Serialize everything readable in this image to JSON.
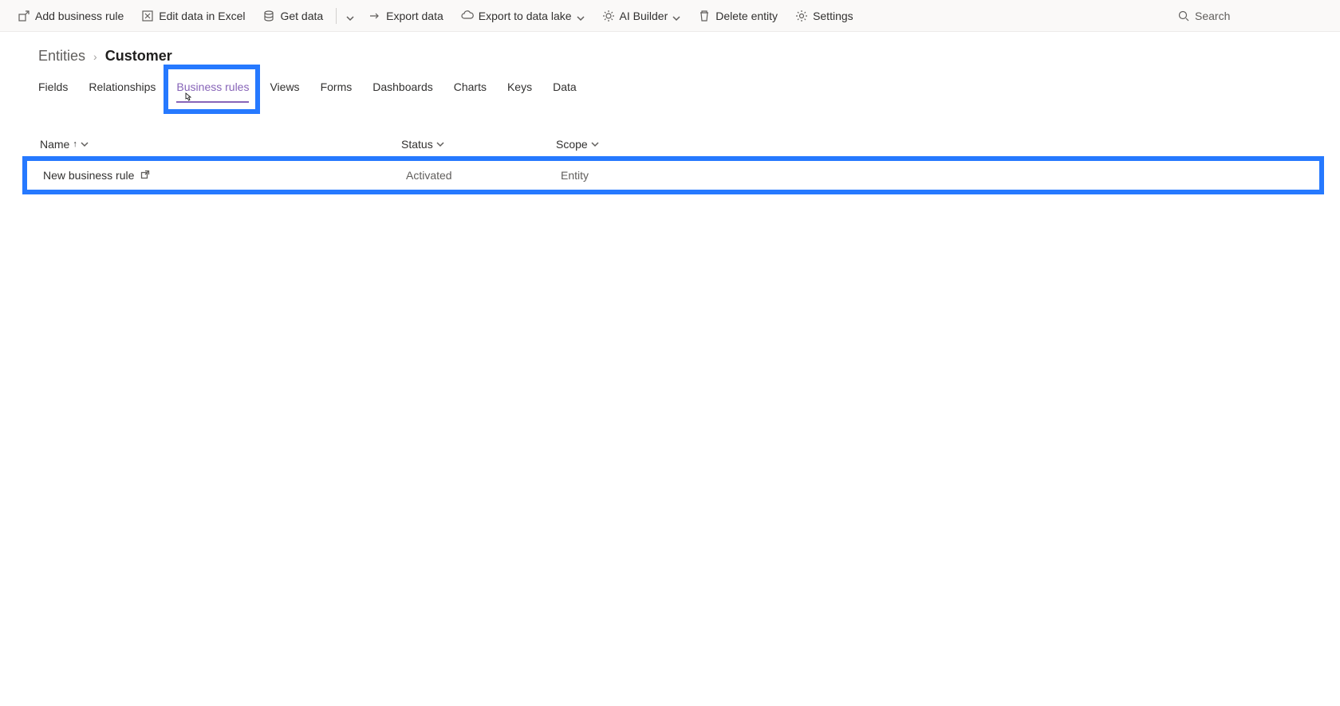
{
  "commandBar": {
    "addBusinessRule": "Add business rule",
    "editInExcel": "Edit data in Excel",
    "getData": "Get data",
    "exportData": "Export data",
    "exportToLake": "Export to data lake",
    "aiBuilder": "AI Builder",
    "deleteEntity": "Delete entity",
    "settings": "Settings",
    "searchPlaceholder": "Search"
  },
  "breadcrumb": {
    "root": "Entities",
    "current": "Customer"
  },
  "tabs": {
    "fields": "Fields",
    "relationships": "Relationships",
    "businessRules": "Business rules",
    "views": "Views",
    "forms": "Forms",
    "dashboards": "Dashboards",
    "charts": "Charts",
    "keys": "Keys",
    "data": "Data"
  },
  "table": {
    "headers": {
      "name": "Name",
      "status": "Status",
      "scope": "Scope"
    },
    "rows": [
      {
        "name": "New business rule",
        "status": "Activated",
        "scope": "Entity"
      }
    ]
  }
}
